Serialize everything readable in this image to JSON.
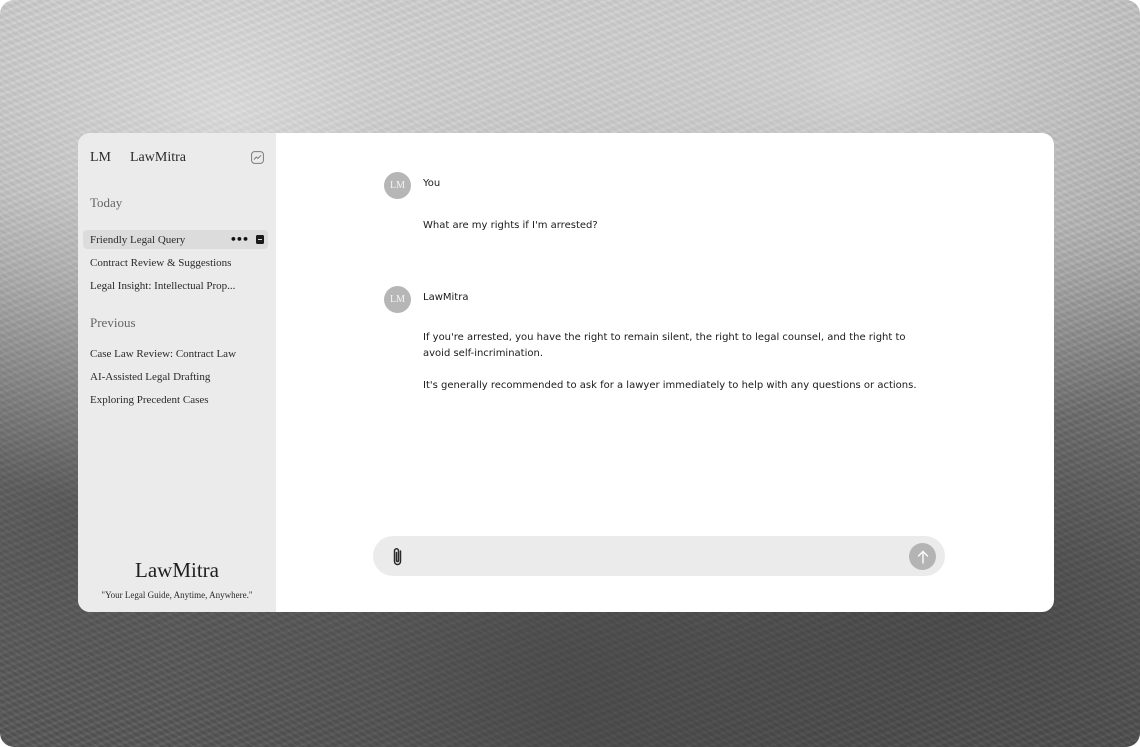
{
  "sidebar": {
    "brand_initials": "LM",
    "brand_name": "LawMitra",
    "today_label": "Today",
    "today_items": [
      {
        "label": "Friendly Legal Query"
      },
      {
        "label": "Contract Review & Suggestions"
      },
      {
        "label": "Legal Insight: Intellectual Prop..."
      }
    ],
    "previous_label": "Previous",
    "previous_items": [
      {
        "label": "Case Law Review: Contract Law"
      },
      {
        "label": "AI-Assisted Legal Drafting"
      },
      {
        "label": "Exploring Precedent Cases"
      }
    ],
    "item_more_glyph": "•••",
    "footer_brand": "LawMitra",
    "footer_tagline": "\"Your Legal Guide, Anytime, Anywhere.\""
  },
  "chat": {
    "messages": [
      {
        "avatar": "LM",
        "sender": "You",
        "paragraphs": [
          "What are my rights if I'm arrested?"
        ]
      },
      {
        "avatar": "LM",
        "sender": "LawMitra",
        "paragraphs": [
          "If you're arrested, you have the right to remain silent, the right to legal counsel, and the right to avoid self-incrimination.",
          "It's generally recommended to ask for a lawyer immediately to help with any questions or actions."
        ]
      }
    ]
  },
  "composer": {
    "value": "",
    "placeholder": ""
  },
  "icons": {
    "header": "trend-chart-icon",
    "attach": "paperclip-icon",
    "send": "arrow-up-icon",
    "item_more": "more-dots-icon",
    "item_archive": "archive-icon"
  },
  "colors": {
    "sidebar_bg": "#ebebeb",
    "active_item_bg": "#dcdcdc",
    "avatar_bg": "#b6b6b6",
    "composer_bg": "#ebebeb",
    "send_button_bg": "#b4b4b4"
  }
}
